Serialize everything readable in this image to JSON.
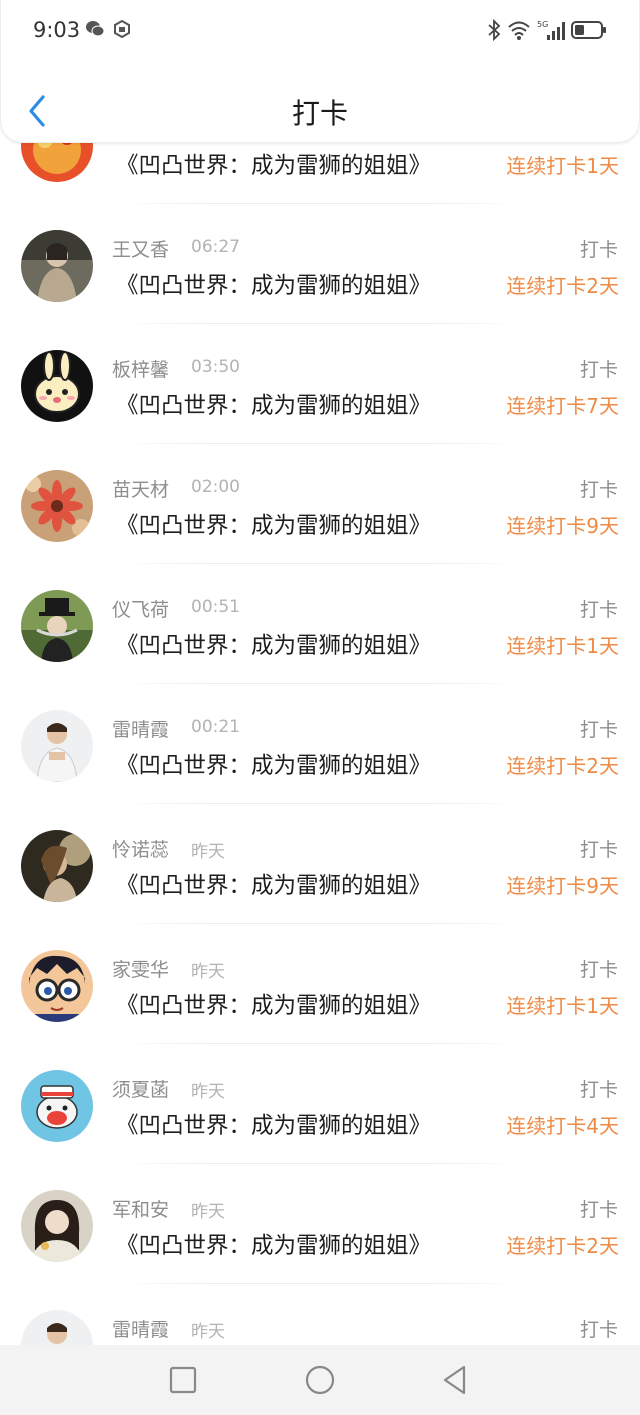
{
  "status_bar": {
    "time": "9:03",
    "left_icons": [
      "wechat-icon",
      "app-notification-icon"
    ],
    "right_icons": [
      "bluetooth-icon",
      "wifi-icon",
      "5g-signal-icon",
      "battery-icon"
    ],
    "network": "5G"
  },
  "header": {
    "title": "打卡",
    "back_icon": "chevron-left-icon"
  },
  "colors": {
    "accent_blue": "#2b8de3",
    "streak_orange": "#ef8a45"
  },
  "top_partial_row": {
    "book": "《凹凸世界：成为雷狮的姐姐》",
    "streak": "连续打卡1天"
  },
  "records": [
    {
      "name": "王又香",
      "time": "06:27",
      "action": "打卡",
      "book": "《凹凸世界：成为雷狮的姐姐》",
      "streak": "连续打卡2天"
    },
    {
      "name": "板梓馨",
      "time": "03:50",
      "action": "打卡",
      "book": "《凹凸世界：成为雷狮的姐姐》",
      "streak": "连续打卡7天"
    },
    {
      "name": "苗天材",
      "time": "02:00",
      "action": "打卡",
      "book": "《凹凸世界：成为雷狮的姐姐》",
      "streak": "连续打卡9天"
    },
    {
      "name": "仪飞荷",
      "time": "00:51",
      "action": "打卡",
      "book": "《凹凸世界：成为雷狮的姐姐》",
      "streak": "连续打卡1天"
    },
    {
      "name": "雷晴霞",
      "time": "00:21",
      "action": "打卡",
      "book": "《凹凸世界：成为雷狮的姐姐》",
      "streak": "连续打卡2天"
    },
    {
      "name": "怜诺蕊",
      "time": "昨天",
      "action": "打卡",
      "book": "《凹凸世界：成为雷狮的姐姐》",
      "streak": "连续打卡9天"
    },
    {
      "name": "家雯华",
      "time": "昨天",
      "action": "打卡",
      "book": "《凹凸世界：成为雷狮的姐姐》",
      "streak": "连续打卡1天"
    },
    {
      "name": "须夏菡",
      "time": "昨天",
      "action": "打卡",
      "book": "《凹凸世界：成为雷狮的姐姐》",
      "streak": "连续打卡4天"
    },
    {
      "name": "军和安",
      "time": "昨天",
      "action": "打卡",
      "book": "《凹凸世界：成为雷狮的姐姐》",
      "streak": "连续打卡2天"
    },
    {
      "name": "雷晴霞",
      "time": "昨天",
      "action": "打卡",
      "book": "",
      "streak": ""
    }
  ],
  "nav_bar": {
    "buttons": [
      "recent-apps-square-icon",
      "home-circle-icon",
      "back-triangle-icon"
    ]
  }
}
